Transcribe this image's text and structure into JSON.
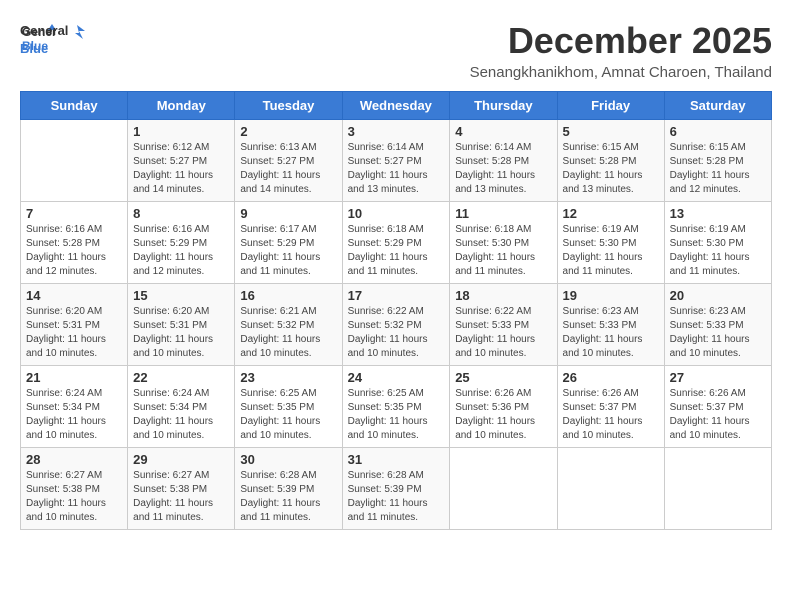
{
  "header": {
    "logo_general": "General",
    "logo_blue": "Blue",
    "title": "December 2025",
    "subtitle": "Senangkhanikhom, Amnat Charoen, Thailand"
  },
  "days_of_week": [
    "Sunday",
    "Monday",
    "Tuesday",
    "Wednesday",
    "Thursday",
    "Friday",
    "Saturday"
  ],
  "weeks": [
    [
      {
        "day": "",
        "info": ""
      },
      {
        "day": "1",
        "info": "Sunrise: 6:12 AM\nSunset: 5:27 PM\nDaylight: 11 hours\nand 14 minutes."
      },
      {
        "day": "2",
        "info": "Sunrise: 6:13 AM\nSunset: 5:27 PM\nDaylight: 11 hours\nand 14 minutes."
      },
      {
        "day": "3",
        "info": "Sunrise: 6:14 AM\nSunset: 5:27 PM\nDaylight: 11 hours\nand 13 minutes."
      },
      {
        "day": "4",
        "info": "Sunrise: 6:14 AM\nSunset: 5:28 PM\nDaylight: 11 hours\nand 13 minutes."
      },
      {
        "day": "5",
        "info": "Sunrise: 6:15 AM\nSunset: 5:28 PM\nDaylight: 11 hours\nand 13 minutes."
      },
      {
        "day": "6",
        "info": "Sunrise: 6:15 AM\nSunset: 5:28 PM\nDaylight: 11 hours\nand 12 minutes."
      }
    ],
    [
      {
        "day": "7",
        "info": "Sunrise: 6:16 AM\nSunset: 5:28 PM\nDaylight: 11 hours\nand 12 minutes."
      },
      {
        "day": "8",
        "info": "Sunrise: 6:16 AM\nSunset: 5:29 PM\nDaylight: 11 hours\nand 12 minutes."
      },
      {
        "day": "9",
        "info": "Sunrise: 6:17 AM\nSunset: 5:29 PM\nDaylight: 11 hours\nand 11 minutes."
      },
      {
        "day": "10",
        "info": "Sunrise: 6:18 AM\nSunset: 5:29 PM\nDaylight: 11 hours\nand 11 minutes."
      },
      {
        "day": "11",
        "info": "Sunrise: 6:18 AM\nSunset: 5:30 PM\nDaylight: 11 hours\nand 11 minutes."
      },
      {
        "day": "12",
        "info": "Sunrise: 6:19 AM\nSunset: 5:30 PM\nDaylight: 11 hours\nand 11 minutes."
      },
      {
        "day": "13",
        "info": "Sunrise: 6:19 AM\nSunset: 5:30 PM\nDaylight: 11 hours\nand 11 minutes."
      }
    ],
    [
      {
        "day": "14",
        "info": "Sunrise: 6:20 AM\nSunset: 5:31 PM\nDaylight: 11 hours\nand 10 minutes."
      },
      {
        "day": "15",
        "info": "Sunrise: 6:20 AM\nSunset: 5:31 PM\nDaylight: 11 hours\nand 10 minutes."
      },
      {
        "day": "16",
        "info": "Sunrise: 6:21 AM\nSunset: 5:32 PM\nDaylight: 11 hours\nand 10 minutes."
      },
      {
        "day": "17",
        "info": "Sunrise: 6:22 AM\nSunset: 5:32 PM\nDaylight: 11 hours\nand 10 minutes."
      },
      {
        "day": "18",
        "info": "Sunrise: 6:22 AM\nSunset: 5:33 PM\nDaylight: 11 hours\nand 10 minutes."
      },
      {
        "day": "19",
        "info": "Sunrise: 6:23 AM\nSunset: 5:33 PM\nDaylight: 11 hours\nand 10 minutes."
      },
      {
        "day": "20",
        "info": "Sunrise: 6:23 AM\nSunset: 5:33 PM\nDaylight: 11 hours\nand 10 minutes."
      }
    ],
    [
      {
        "day": "21",
        "info": "Sunrise: 6:24 AM\nSunset: 5:34 PM\nDaylight: 11 hours\nand 10 minutes."
      },
      {
        "day": "22",
        "info": "Sunrise: 6:24 AM\nSunset: 5:34 PM\nDaylight: 11 hours\nand 10 minutes."
      },
      {
        "day": "23",
        "info": "Sunrise: 6:25 AM\nSunset: 5:35 PM\nDaylight: 11 hours\nand 10 minutes."
      },
      {
        "day": "24",
        "info": "Sunrise: 6:25 AM\nSunset: 5:35 PM\nDaylight: 11 hours\nand 10 minutes."
      },
      {
        "day": "25",
        "info": "Sunrise: 6:26 AM\nSunset: 5:36 PM\nDaylight: 11 hours\nand 10 minutes."
      },
      {
        "day": "26",
        "info": "Sunrise: 6:26 AM\nSunset: 5:37 PM\nDaylight: 11 hours\nand 10 minutes."
      },
      {
        "day": "27",
        "info": "Sunrise: 6:26 AM\nSunset: 5:37 PM\nDaylight: 11 hours\nand 10 minutes."
      }
    ],
    [
      {
        "day": "28",
        "info": "Sunrise: 6:27 AM\nSunset: 5:38 PM\nDaylight: 11 hours\nand 10 minutes."
      },
      {
        "day": "29",
        "info": "Sunrise: 6:27 AM\nSunset: 5:38 PM\nDaylight: 11 hours\nand 11 minutes."
      },
      {
        "day": "30",
        "info": "Sunrise: 6:28 AM\nSunset: 5:39 PM\nDaylight: 11 hours\nand 11 minutes."
      },
      {
        "day": "31",
        "info": "Sunrise: 6:28 AM\nSunset: 5:39 PM\nDaylight: 11 hours\nand 11 minutes."
      },
      {
        "day": "",
        "info": ""
      },
      {
        "day": "",
        "info": ""
      },
      {
        "day": "",
        "info": ""
      }
    ]
  ]
}
